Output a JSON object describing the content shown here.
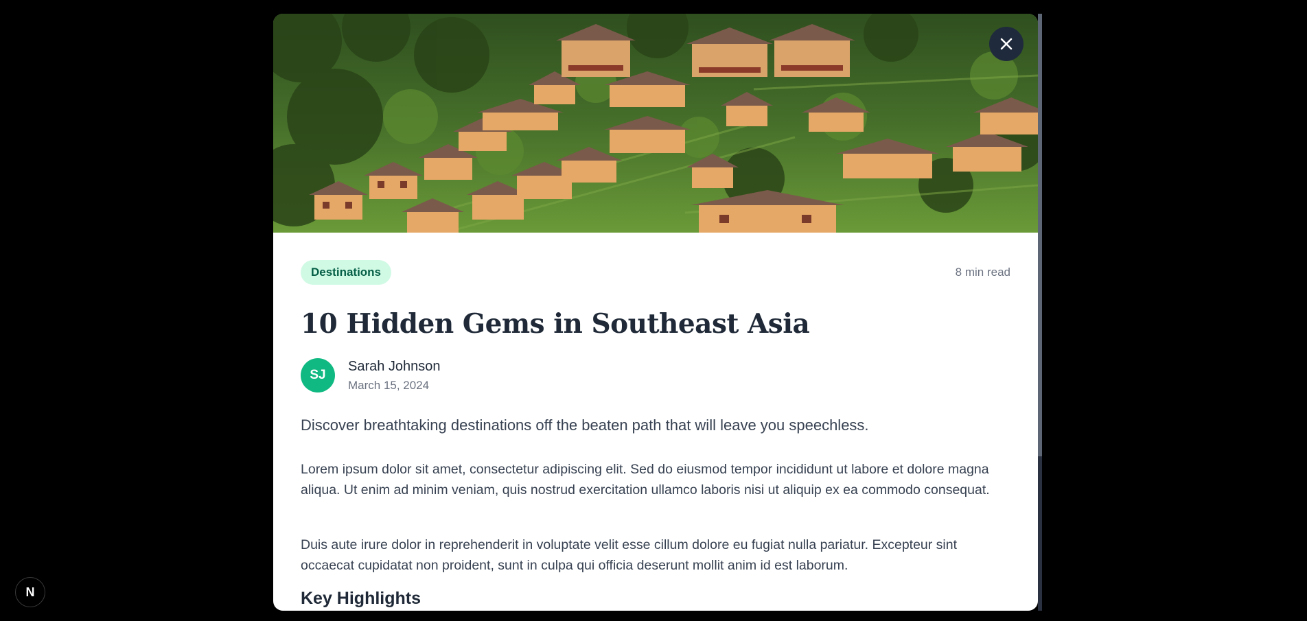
{
  "article": {
    "category": "Destinations",
    "read_time": "8 min read",
    "title": "10 Hidden Gems in Southeast Asia",
    "author": {
      "initials": "SJ",
      "name": "Sarah Johnson",
      "date": "March 15, 2024"
    },
    "lead": "Discover breathtaking destinations off the beaten path that will leave you speechless.",
    "paragraphs": [
      "Lorem ipsum dolor sit amet, consectetur adipiscing elit. Sed do eiusmod tempor incididunt ut labore et dolore magna aliqua. Ut enim ad minim veniam, quis nostrud exercitation ullamco laboris nisi ut aliquip ex ea commodo consequat.",
      "Duis aute irure dolor in reprehenderit in voluptate velit esse cillum dolore eu fugiat nulla pariatur. Excepteur sint occaecat cupidatat non proident, sunt in culpa qui officia deserunt mollit anim id est laborum."
    ],
    "highlights_heading": "Key Highlights"
  },
  "next_badge": {
    "letter": "N"
  },
  "colors": {
    "accent": "#10b981",
    "badge_bg": "#d1fae5",
    "badge_text": "#065f46",
    "close_button_bg": "#1f2a3c"
  },
  "icons": {
    "close": "close-icon",
    "next": "nextjs-logo-icon"
  }
}
